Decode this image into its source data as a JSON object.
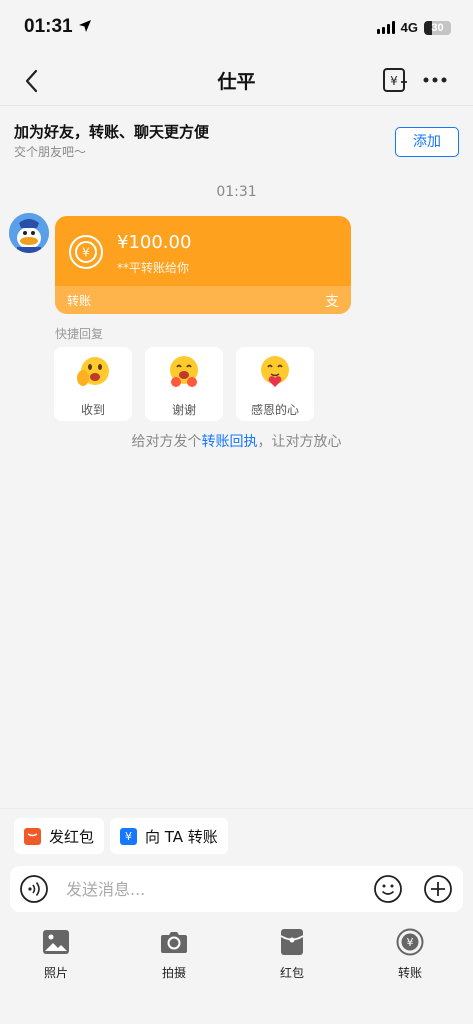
{
  "status_bar": {
    "time": "01:31",
    "network": "4G",
    "battery": "30",
    "battery_level": 0.3
  },
  "nav": {
    "title": "仕平"
  },
  "friend_banner": {
    "title": "加为好友，转账、聊天更方便",
    "subtitle": "交个朋友吧～",
    "add_button": "添加"
  },
  "chat": {
    "timestamp": "01:31",
    "transfer_card": {
      "amount": "¥100.00",
      "description": "**平转账给你",
      "footer_label": "转账",
      "logo": "支"
    }
  },
  "quick_reply": {
    "title": "快捷回复",
    "items": [
      {
        "label": "收到",
        "icon": "waving-face-icon"
      },
      {
        "label": "谢谢",
        "icon": "thank-you-face-icon"
      },
      {
        "label": "感恩的心",
        "icon": "grateful-face-icon"
      }
    ]
  },
  "receipt_hint": {
    "prefix": "给对方发个",
    "link": "转账回执",
    "suffix": "，让对方放心"
  },
  "action_chips": [
    {
      "label": "发红包",
      "icon": "red-packet-icon"
    },
    {
      "label": "向 TA 转账",
      "icon": "yuan-transfer-icon"
    }
  ],
  "input_bar": {
    "placeholder": "发送消息..."
  },
  "toolbar": [
    {
      "label": "照片",
      "icon": "photo-icon"
    },
    {
      "label": "拍摄",
      "icon": "camera-icon"
    },
    {
      "label": "红包",
      "icon": "red-packet-icon"
    },
    {
      "label": "转账",
      "icon": "transfer-icon"
    }
  ],
  "colors": {
    "accent": "#1677ff",
    "card": "#fea11e",
    "background": "#f4f4f4"
  }
}
